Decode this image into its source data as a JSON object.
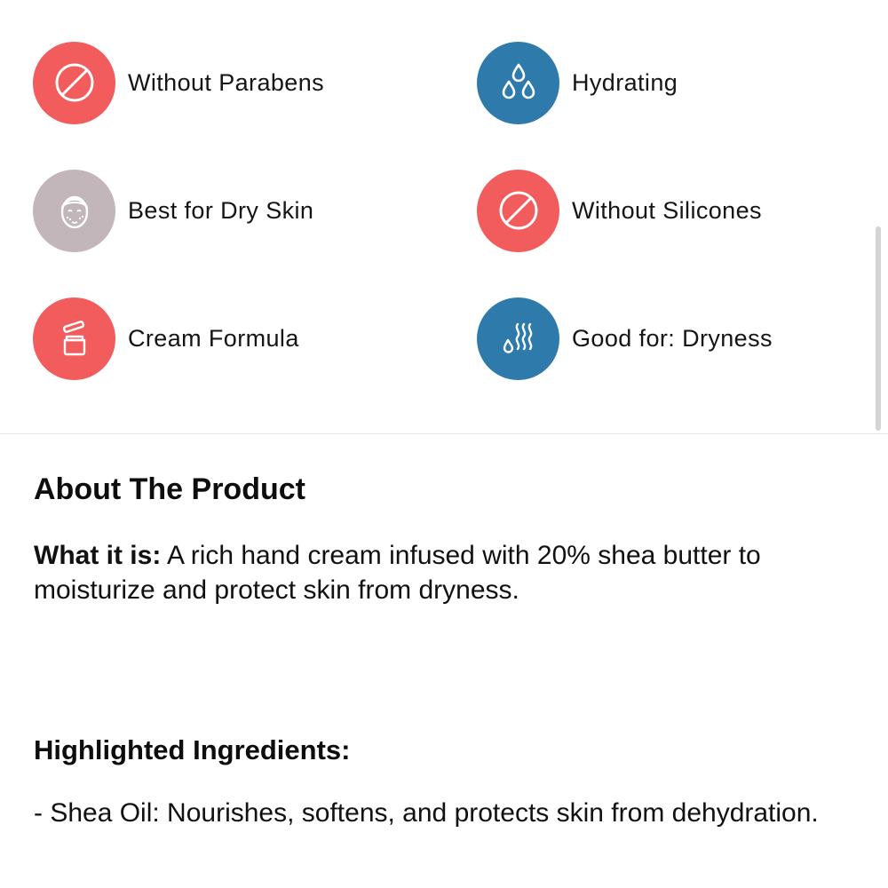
{
  "colors": {
    "red": "#f25c5c",
    "blue": "#2e7bab",
    "gray": "#c2b6ba"
  },
  "features": [
    {
      "label": "Without Parabens",
      "icon": "prohibited-icon",
      "color": "red"
    },
    {
      "label": "Hydrating",
      "icon": "water-drops-icon",
      "color": "blue"
    },
    {
      "label": "Best for Dry Skin",
      "icon": "dry-skin-face-icon",
      "color": "gray"
    },
    {
      "label": "Without Silicones",
      "icon": "prohibited-icon",
      "color": "red"
    },
    {
      "label": "Cream Formula",
      "icon": "cream-jar-icon",
      "color": "red"
    },
    {
      "label": "Good for: Dryness",
      "icon": "dryness-waves-icon",
      "color": "blue"
    }
  ],
  "about": {
    "title": "About The Product",
    "what_it_is_label": "What it is:",
    "what_it_is_text": " A rich hand cream infused with 20% shea butter to moisturize and protect skin from dryness.",
    "ingredients_title": "Highlighted Ingredients:",
    "ingredients": [
      "- Shea Oil: Nourishes, softens, and protects skin from dehydration."
    ]
  }
}
